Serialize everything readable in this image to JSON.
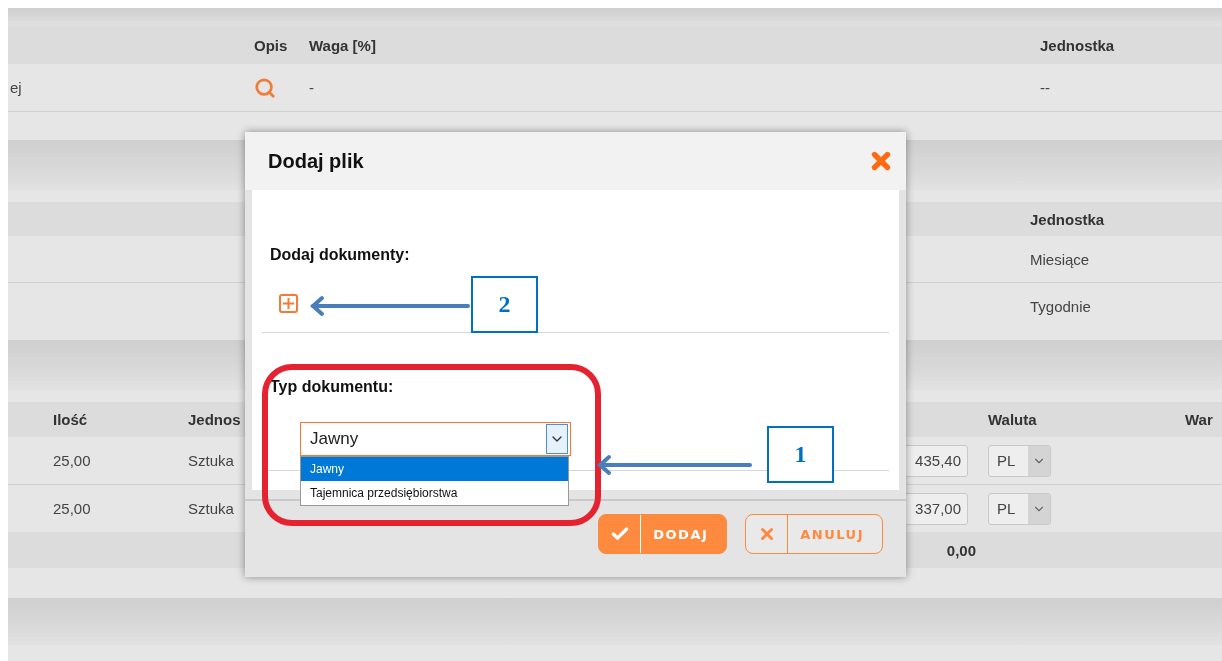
{
  "table_1": {
    "columns": [
      "Opis",
      "Waga [%]",
      "Jednostka"
    ],
    "rows": [
      {
        "name": "ej",
        "waga": "-",
        "jednostka": "--"
      }
    ]
  },
  "table_2": {
    "columns": [
      "Jednostka"
    ],
    "rows": [
      "Miesiące",
      "Tygodnie"
    ]
  },
  "table_3": {
    "columns": [
      "Ilość",
      "Jednos",
      "Waluta",
      "War"
    ],
    "rows": [
      {
        "ilosc": "25,00",
        "jednostka": "Sztuka",
        "cena": "435,40",
        "waluta": "PL"
      },
      {
        "ilosc": "25,00",
        "jednostka": "Sztuka",
        "cena": "337,00",
        "waluta": "PL"
      }
    ],
    "total": "0,00"
  },
  "dialog": {
    "title": "Dodaj plik",
    "add_documents_label": "Dodaj dokumenty:",
    "document_type_label": "Typ dokumentu:",
    "document_type": {
      "value": "Jawny",
      "options": [
        {
          "label": "Jawny",
          "selected": true
        },
        {
          "label": "Tajemnica przedsiębiorstwa",
          "selected": false
        }
      ]
    },
    "buttons": [
      {
        "label": "DODAJ",
        "kind": "primary"
      },
      {
        "label": "ANULUJ",
        "kind": "secondary"
      }
    ]
  },
  "annotations": [
    {
      "label": "1"
    },
    {
      "label": "2"
    }
  ]
}
